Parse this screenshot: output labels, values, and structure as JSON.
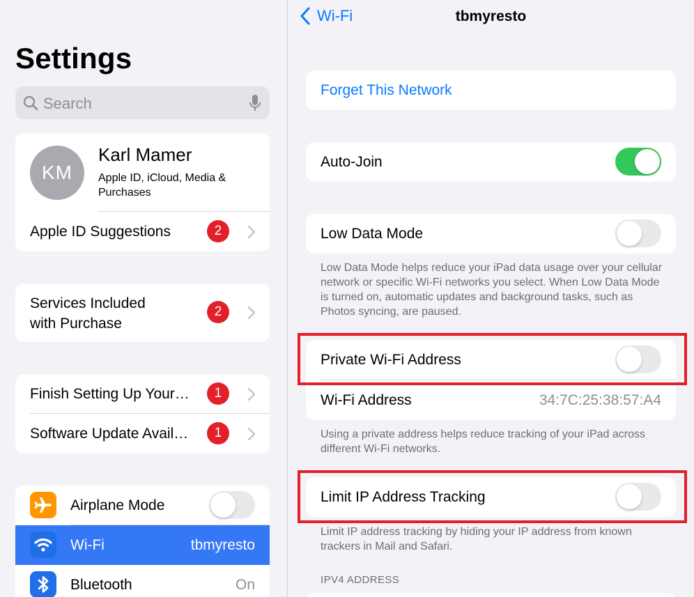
{
  "sidebar": {
    "title": "Settings",
    "search_placeholder": "Search",
    "profile": {
      "initials": "KM",
      "name": "Karl Mamer",
      "subtitle": "Apple ID, iCloud, Media & Purchases"
    },
    "apple_id_suggestions": {
      "label": "Apple ID Suggestions",
      "badge": "2"
    },
    "services": {
      "label_line1": "Services Included",
      "label_line2": "with Purchase",
      "badge": "2"
    },
    "finish_setup": {
      "label": "Finish Setting Up Your…",
      "badge": "1"
    },
    "software_update": {
      "label": "Software Update Avail…",
      "badge": "1"
    },
    "airplane": {
      "label": "Airplane Mode",
      "enabled": false
    },
    "wifi": {
      "label": "Wi-Fi",
      "value": "tbmyresto"
    },
    "bluetooth": {
      "label": "Bluetooth",
      "value": "On"
    }
  },
  "detail": {
    "back_label": "Wi-Fi",
    "title": "tbmyresto",
    "forget_label": "Forget This Network",
    "auto_join": {
      "label": "Auto-Join",
      "enabled": true
    },
    "low_data": {
      "label": "Low Data Mode",
      "enabled": false,
      "footnote": "Low Data Mode helps reduce your iPad data usage over your cellular network or specific Wi-Fi networks you select. When Low Data Mode is turned on, automatic updates and background tasks, such as Photos syncing, are paused."
    },
    "private_address": {
      "label": "Private Wi-Fi Address",
      "enabled": false,
      "wifi_address_label": "Wi-Fi Address",
      "wifi_address_value": "34:7C:25:38:57:A4",
      "footnote": "Using a private address helps reduce tracking of your iPad across different Wi-Fi networks."
    },
    "limit_ip": {
      "label": "Limit IP Address Tracking",
      "enabled": false,
      "footnote": "Limit IP address tracking by hiding your IP address from known trackers in Mail and Safari."
    },
    "ipv4_header": "IPV4 ADDRESS"
  },
  "colors": {
    "accent": "#0a7aff",
    "toggle_on": "#34c759",
    "badge": "#e2202a",
    "highlight": "#e41e2b",
    "selected_row": "#3478f6",
    "airplane_icon": "#ff9500",
    "wifi_icon": "#1f6fe8",
    "bluetooth_icon": "#1f6fe8"
  }
}
